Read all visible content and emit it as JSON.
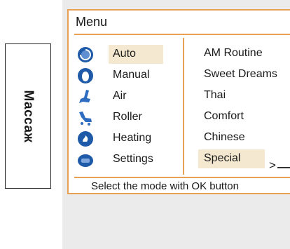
{
  "side_label": "Массаж",
  "menu": {
    "title": "Menu",
    "left_items": [
      {
        "label": "Auto",
        "icon": "auto-icon",
        "selected": true
      },
      {
        "label": "Manual",
        "icon": "manual-icon",
        "selected": false
      },
      {
        "label": "Air",
        "icon": "air-icon",
        "selected": false
      },
      {
        "label": "Roller",
        "icon": "roller-icon",
        "selected": false
      },
      {
        "label": "Heating",
        "icon": "heating-icon",
        "selected": false
      },
      {
        "label": "Settings",
        "icon": "settings-icon",
        "selected": false
      }
    ],
    "right_items": [
      {
        "label": "AM Routine",
        "selected": false
      },
      {
        "label": "Sweet Dreams",
        "selected": false
      },
      {
        "label": "Thai",
        "selected": false
      },
      {
        "label": "Comfort",
        "selected": false
      },
      {
        "label": "Chinese",
        "selected": false
      },
      {
        "label": "Special",
        "selected": true
      }
    ],
    "arrow_text": ">",
    "status": "Select the mode with OK button"
  },
  "colors": {
    "accent": "#e8a055",
    "highlight": "#f4e8d0",
    "icon_blue": "#1e5aa8",
    "device_bg": "#ecebeb"
  }
}
